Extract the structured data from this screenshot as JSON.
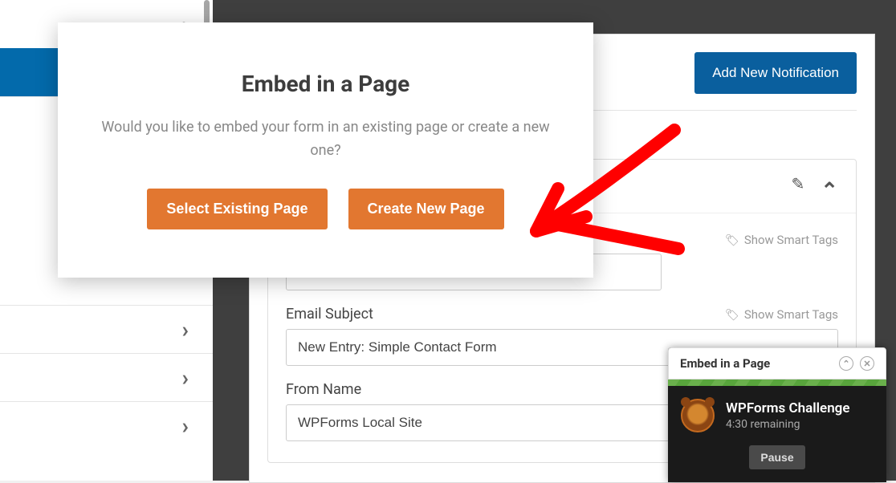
{
  "modal": {
    "title": "Embed in a Page",
    "text": "Would you like to embed your form in an existing page or create a new one?",
    "btn_existing": "Select Existing Page",
    "btn_new": "Create New Page"
  },
  "header": {
    "add_notification": "Add New Notification"
  },
  "form": {
    "smart_tags_label": "Show Smart Tags",
    "email_subject_label": "Email Subject",
    "email_subject_value": "New Entry: Simple Contact Form",
    "from_name_label": "From Name",
    "from_name_value": "WPForms Local Site"
  },
  "challenge": {
    "bar_title": "Embed in a Page",
    "name": "WPForms Challenge",
    "remaining": "4:30 remaining",
    "pause": "Pause"
  }
}
